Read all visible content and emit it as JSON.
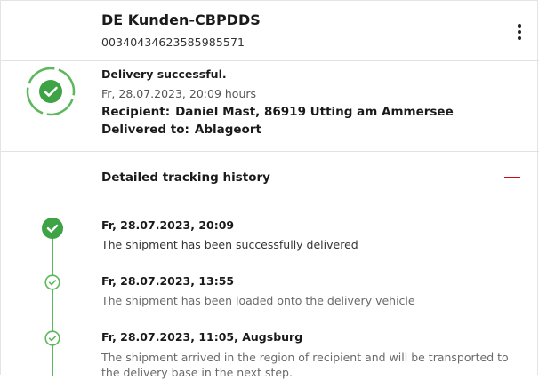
{
  "shipment": {
    "name": "DE Kunden-CBPDDS",
    "tracking_number": "00340434623585985571"
  },
  "menu": {
    "icon": "more-vertical-icon"
  },
  "status": {
    "icon": "check-circle-icon",
    "title": "Delivery successful.",
    "time": "Fr, 28.07.2023, 20:09 hours",
    "recipient_label": "Recipient:",
    "recipient_value": "Daniel Mast, 86919 Utting am Ammersee",
    "delivered_to_label": "Delivered to:",
    "delivered_to_value": "Ablageort",
    "color": "#5cb85c"
  },
  "history": {
    "title": "Detailed tracking history",
    "collapse_icon": "minus-icon",
    "accent_color": "#d40511",
    "events": [
      {
        "date": "Fr, 28.07.2023, 20:09",
        "description": "The shipment has been successfully delivered"
      },
      {
        "date": "Fr, 28.07.2023, 13:55",
        "description": "The shipment has been loaded onto the delivery vehicle"
      },
      {
        "date": "Fr, 28.07.2023, 11:05, Augsburg",
        "description": "The shipment arrived in the region of recipient and will be transported to the delivery base in the next step."
      }
    ]
  }
}
